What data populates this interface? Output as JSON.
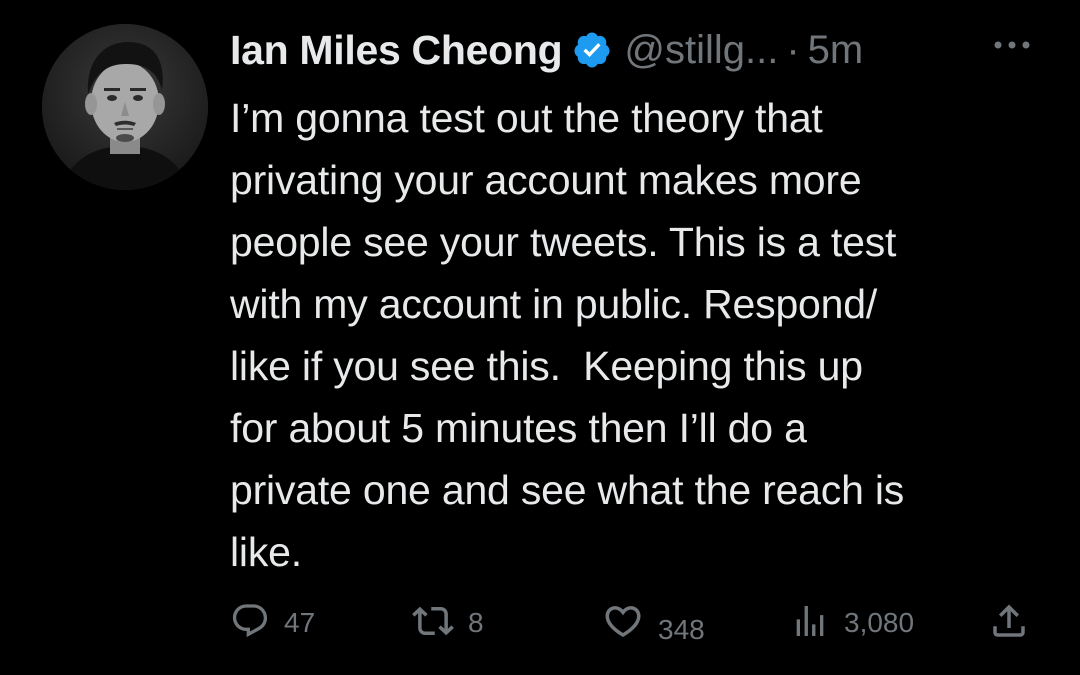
{
  "tweet": {
    "author": {
      "display_name": "Ian Miles Cheong",
      "handle": "@stillg...",
      "verified": true
    },
    "separator": "·",
    "timestamp": "5m",
    "text": "I’m gonna test out the theory that\nprivating your account makes more\npeople see your tweets. This is a test\nwith my account in public. Respond/\nlike if you see this.  Keeping this up\nfor about 5 minutes then I’ll do a\nprivate one and see what the reach is\nlike.",
    "actions": {
      "reply": {
        "icon": "reply-icon",
        "count": "47"
      },
      "retweet": {
        "icon": "retweet-icon",
        "count": "8"
      },
      "like": {
        "icon": "heart-icon",
        "count": "348"
      },
      "views": {
        "icon": "views-icon",
        "count": "3,080"
      },
      "share": {
        "icon": "share-icon"
      }
    }
  },
  "colors": {
    "background": "#000000",
    "text_primary": "#e7e9ea",
    "text_secondary": "#71767b",
    "verified_blue": "#1d9bf0"
  }
}
